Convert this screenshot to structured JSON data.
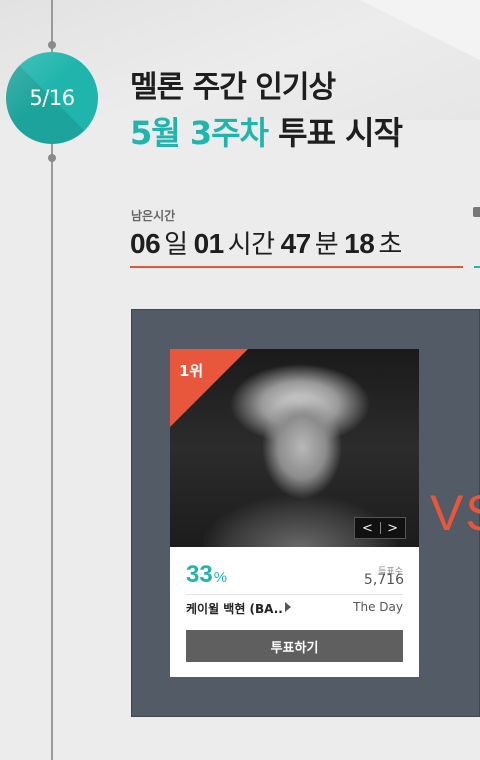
{
  "event": {
    "date_badge": "5/16",
    "title_line1": "멜론 주간 인기상",
    "title_line2_highlight": "5월 3주차",
    "title_line2_rest": " 투표 시작"
  },
  "countdown": {
    "label": "남은시간",
    "days": "06",
    "days_unit": "일",
    "hours": "01",
    "hours_unit": "시간",
    "minutes": "47",
    "minutes_unit": "분",
    "seconds": "18",
    "seconds_unit": "초"
  },
  "candidate": {
    "rank": "1위",
    "nav_prev": "<",
    "nav_next": ">",
    "percent": "33",
    "percent_unit": "%",
    "votes_label": "득표수",
    "votes": "5,716",
    "artist": "케이윌 백현 (BA..",
    "song": "The Day",
    "vote_button": "투표하기"
  },
  "vs_text": "VS",
  "colors": {
    "accent_teal": "#1fb5ad",
    "accent_orange": "#e8573c",
    "panel_bg": "#535b67"
  }
}
